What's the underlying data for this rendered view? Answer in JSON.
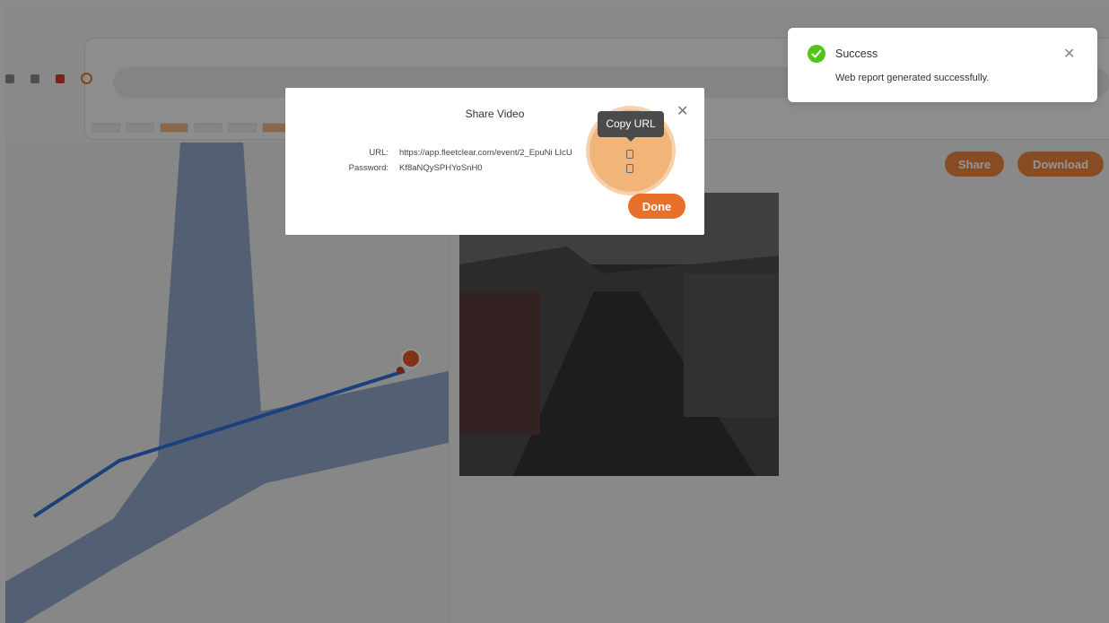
{
  "colors": {
    "accent": "#e8702a",
    "success": "#52c41a",
    "route": "#2f6fd6",
    "road": "#8fa6c7"
  },
  "background": {
    "share_label": "Share",
    "download_label": "Download"
  },
  "modal": {
    "title": "Share Video",
    "url_label": "URL:",
    "url_value": "https://app.fleetclear.com/event/2_EpuNi LIcU",
    "password_label": "Password:",
    "password_value": "Kf8aNQySPHYoSnH0",
    "copy_tooltip": "Copy URL",
    "done_label": "Done",
    "close_icon": "close-icon",
    "copy_icon": "copy-icon"
  },
  "toast": {
    "title": "Success",
    "message": "Web report generated successfully.",
    "icon": "check-circle-icon",
    "close_icon": "close-icon"
  }
}
